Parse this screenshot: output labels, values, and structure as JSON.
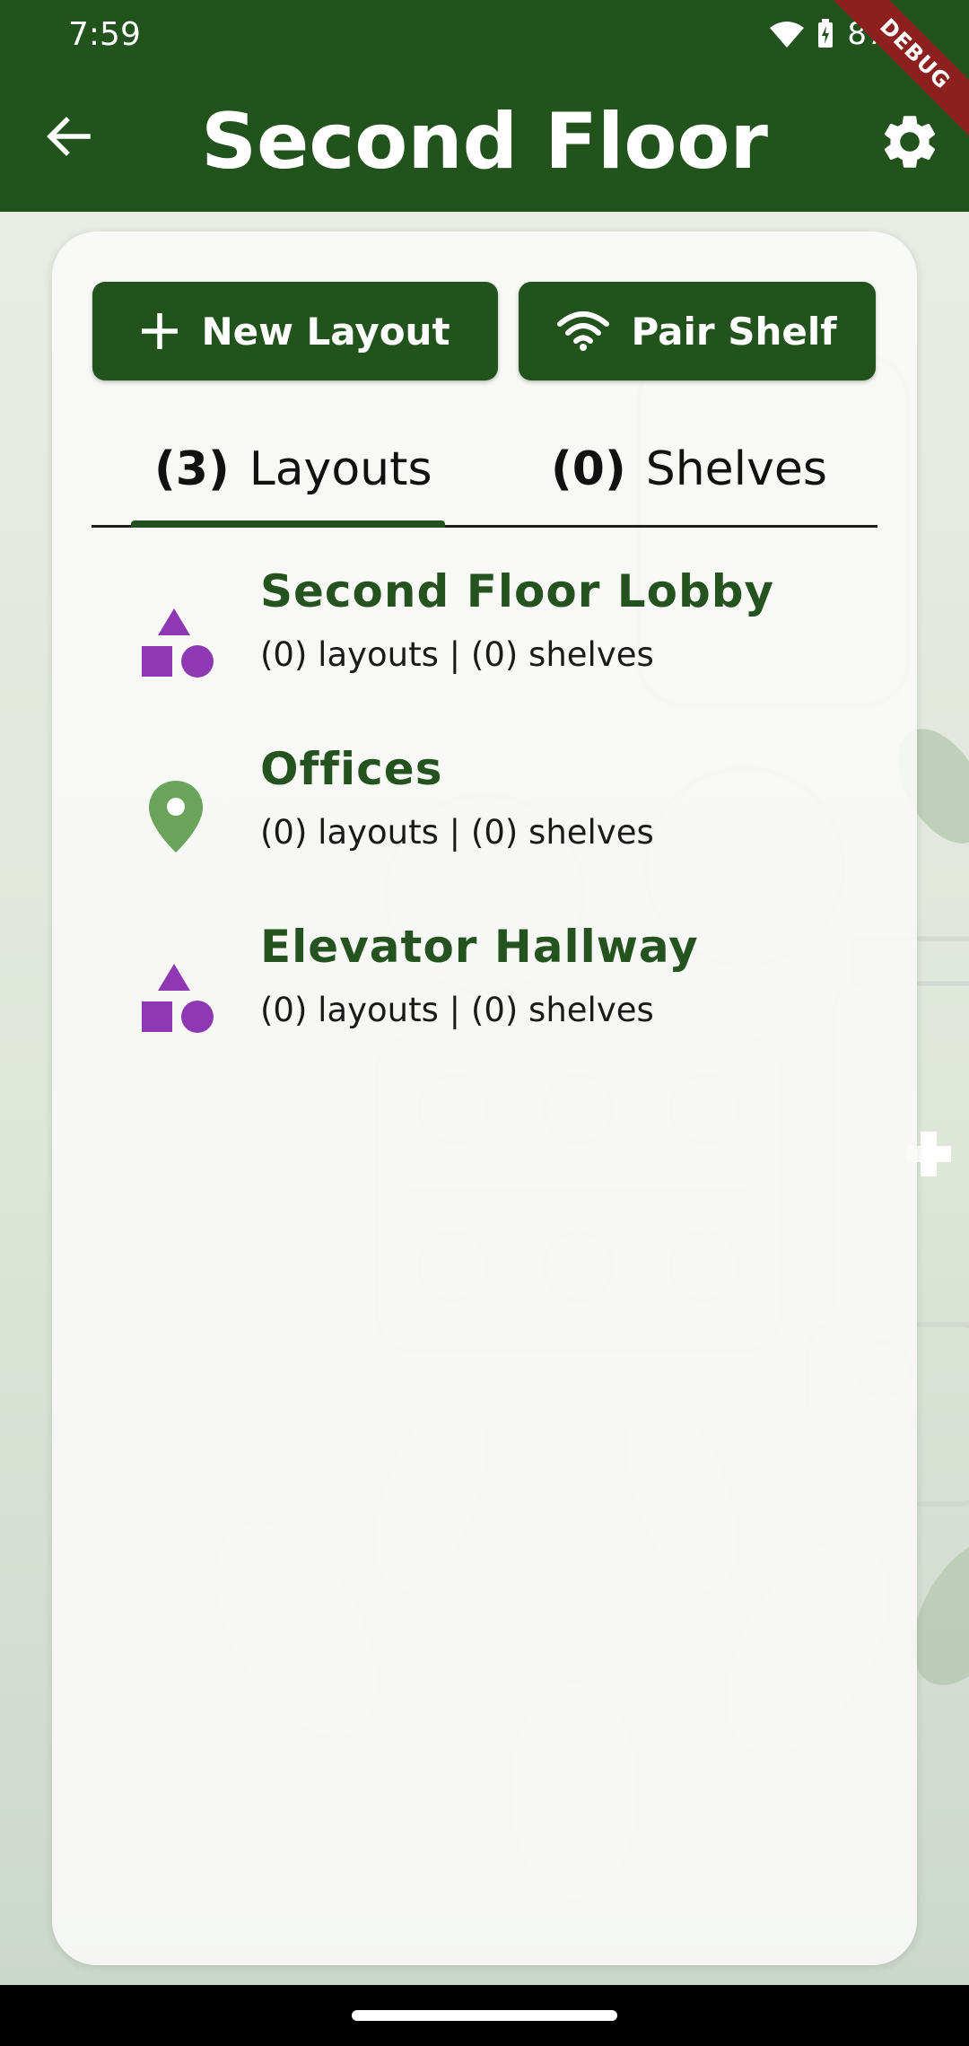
{
  "status_bar": {
    "time": "7:59",
    "battery": "87%",
    "debug_label": "DEBUG"
  },
  "app_bar": {
    "title": "Second Floor",
    "back_icon": "arrow-left-icon",
    "settings_icon": "gear-icon"
  },
  "actions": {
    "new_layout_label": "New Layout",
    "pair_shelf_label": "Pair Shelf"
  },
  "tabs": [
    {
      "count": "(3)",
      "label": "Layouts",
      "selected": true
    },
    {
      "count": "(0)",
      "label": "Shelves",
      "selected": false
    }
  ],
  "items": [
    {
      "title": "Second Floor Lobby",
      "subtitle": "(0) layouts | (0) shelves",
      "icon": "shapes-icon"
    },
    {
      "title": "Offices",
      "subtitle": "(0) layouts | (0) shelves",
      "icon": "location-pin-icon"
    },
    {
      "title": "Elevator Hallway",
      "subtitle": "(0) layouts | (0) shelves",
      "icon": "shapes-icon"
    }
  ],
  "colors": {
    "primary": "#23531d",
    "shapes_icon": "#8f38b3",
    "pin_icon": "#6aa35a"
  }
}
